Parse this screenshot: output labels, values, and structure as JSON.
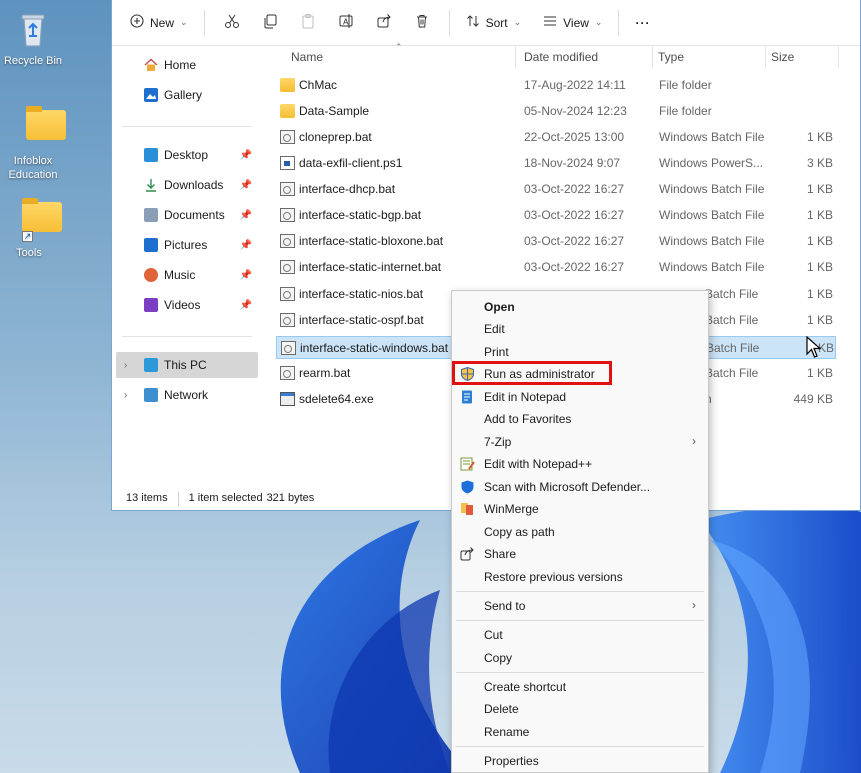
{
  "desktop": {
    "icons": [
      {
        "label": "Recycle Bin",
        "icon": "recycle-bin-icon"
      },
      {
        "label": "Infoblox Education",
        "icon": "folder-icon"
      },
      {
        "label": "Tools",
        "icon": "folder-shortcut-icon"
      }
    ]
  },
  "toolbar": {
    "new_label": "New",
    "sort_label": "Sort",
    "view_label": "View",
    "more_label": "···"
  },
  "nav": {
    "quick": [
      {
        "label": "Home",
        "icon": "home-icon"
      },
      {
        "label": "Gallery",
        "icon": "gallery-icon"
      }
    ],
    "pinned": [
      {
        "label": "Desktop",
        "icon": "desktop-icon"
      },
      {
        "label": "Downloads",
        "icon": "downloads-icon"
      },
      {
        "label": "Documents",
        "icon": "documents-icon"
      },
      {
        "label": "Pictures",
        "icon": "pictures-icon"
      },
      {
        "label": "Music",
        "icon": "music-icon"
      },
      {
        "label": "Videos",
        "icon": "videos-icon"
      }
    ],
    "tree": [
      {
        "label": "This PC",
        "icon": "this-pc-icon",
        "selected": true
      },
      {
        "label": "Network",
        "icon": "network-icon",
        "selected": false
      }
    ]
  },
  "columns": {
    "name": "Name",
    "date": "Date modified",
    "type": "Type",
    "size": "Size"
  },
  "files": [
    {
      "name": "ChMac",
      "date": "17-Aug-2022 14:11",
      "type": "File folder",
      "size": "",
      "kind": "folder"
    },
    {
      "name": "Data-Sample",
      "date": "05-Nov-2024 12:23",
      "type": "File folder",
      "size": "",
      "kind": "folder"
    },
    {
      "name": "cloneprep.bat",
      "date": "22-Oct-2025 13:00",
      "type": "Windows Batch File",
      "size": "1 KB",
      "kind": "bat"
    },
    {
      "name": "data-exfil-client.ps1",
      "date": "18-Nov-2024 9:07",
      "type": "Windows PowerS...",
      "size": "3 KB",
      "kind": "ps1"
    },
    {
      "name": "interface-dhcp.bat",
      "date": "03-Oct-2022 16:27",
      "type": "Windows Batch File",
      "size": "1 KB",
      "kind": "bat"
    },
    {
      "name": "interface-static-bgp.bat",
      "date": "03-Oct-2022 16:27",
      "type": "Windows Batch File",
      "size": "1 KB",
      "kind": "bat"
    },
    {
      "name": "interface-static-bloxone.bat",
      "date": "03-Oct-2022 16:27",
      "type": "Windows Batch File",
      "size": "1 KB",
      "kind": "bat"
    },
    {
      "name": "interface-static-internet.bat",
      "date": "03-Oct-2022 16:27",
      "type": "Windows Batch File",
      "size": "1 KB",
      "kind": "bat"
    },
    {
      "name": "interface-static-nios.bat",
      "date": "",
      "type": "Batch File",
      "size": "1 KB",
      "kind": "bat"
    },
    {
      "name": "interface-static-ospf.bat",
      "date": "",
      "type": "Batch File",
      "size": "1 KB",
      "kind": "bat"
    },
    {
      "name": "interface-static-windows.bat",
      "date": "",
      "type": "Batch File",
      "size": "KB",
      "kind": "bat",
      "selected": true
    },
    {
      "name": "rearm.bat",
      "date": "",
      "type": "Batch File",
      "size": "1 KB",
      "kind": "bat"
    },
    {
      "name": "sdelete64.exe",
      "date": "",
      "type": "n",
      "size": "449 KB",
      "kind": "exe"
    }
  ],
  "status": {
    "items": "13 items",
    "selected": "1 item selected",
    "size": "321 bytes"
  },
  "context_menu": {
    "open": "Open",
    "edit": "Edit",
    "print": "Print",
    "run_as_admin": "Run as administrator",
    "edit_notepad": "Edit in Notepad",
    "add_favorites": "Add to Favorites",
    "seven_zip": "7-Zip",
    "edit_notepadpp": "Edit with Notepad++",
    "scan_defender": "Scan with Microsoft Defender...",
    "winmerge": "WinMerge",
    "copy_path": "Copy as path",
    "share": "Share",
    "restore_versions": "Restore previous versions",
    "send_to": "Send to",
    "cut": "Cut",
    "copy": "Copy",
    "create_shortcut": "Create shortcut",
    "delete": "Delete",
    "rename": "Rename",
    "properties": "Properties"
  },
  "colors": {
    "highlight_box": "#e01111",
    "selection": "#cce4f7",
    "accent": "#0067c0"
  }
}
